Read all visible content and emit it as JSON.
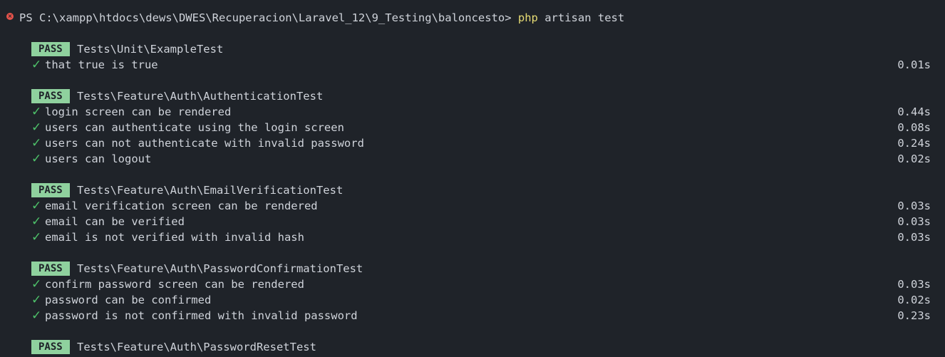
{
  "terminal": {
    "prompt": "PS C:\\xampp\\htdocs\\dews\\DWES\\Recuperacion\\Laravel_12\\9_Testing\\baloncesto> ",
    "command_bin": "php",
    "command_args": " artisan test",
    "prompt_icon": "error-circle-icon",
    "colors": {
      "background": "#1f2329",
      "pass_badge": "#8fd19e",
      "check": "#4ec26a",
      "command": "#e6db74",
      "error_icon": "#e5534b"
    }
  },
  "suites": [
    {
      "badge": "PASS",
      "name": "Tests\\Unit\\ExampleTest",
      "tests": [
        {
          "name": "that true is true",
          "time": "0.01s"
        }
      ]
    },
    {
      "badge": "PASS",
      "name": "Tests\\Feature\\Auth\\AuthenticationTest",
      "tests": [
        {
          "name": "login screen can be rendered",
          "time": "0.44s"
        },
        {
          "name": "users can authenticate using the login screen",
          "time": "0.08s"
        },
        {
          "name": "users can not authenticate with invalid password",
          "time": "0.24s"
        },
        {
          "name": "users can logout",
          "time": "0.02s"
        }
      ]
    },
    {
      "badge": "PASS",
      "name": "Tests\\Feature\\Auth\\EmailVerificationTest",
      "tests": [
        {
          "name": "email verification screen can be rendered",
          "time": "0.03s"
        },
        {
          "name": "email can be verified",
          "time": "0.03s"
        },
        {
          "name": "email is not verified with invalid hash",
          "time": "0.03s"
        }
      ]
    },
    {
      "badge": "PASS",
      "name": "Tests\\Feature\\Auth\\PasswordConfirmationTest",
      "tests": [
        {
          "name": "confirm password screen can be rendered",
          "time": "0.03s"
        },
        {
          "name": "password can be confirmed",
          "time": "0.02s"
        },
        {
          "name": "password is not confirmed with invalid password",
          "time": "0.23s"
        }
      ]
    },
    {
      "badge": "PASS",
      "name": "Tests\\Feature\\Auth\\PasswordResetTest",
      "tests": []
    }
  ]
}
